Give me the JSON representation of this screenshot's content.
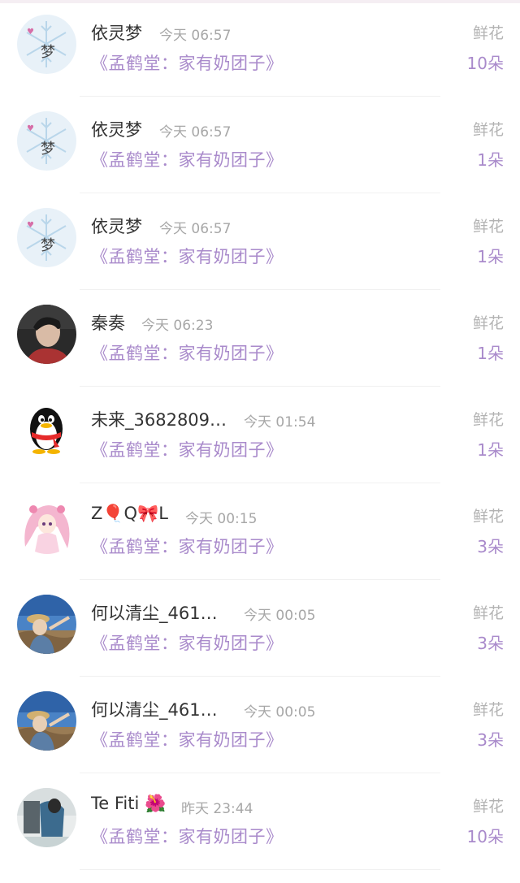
{
  "rows": [
    {
      "name": "依灵梦",
      "time": "今天 06:57",
      "book": "《孟鹤堂：家有奶团子》",
      "gift": "鲜花",
      "count": "10朵",
      "avatar": "avatar-snowflake"
    },
    {
      "name": "依灵梦",
      "time": "今天 06:57",
      "book": "《孟鹤堂：家有奶团子》",
      "gift": "鲜花",
      "count": "1朵",
      "avatar": "avatar-snowflake"
    },
    {
      "name": "依灵梦",
      "time": "今天 06:57",
      "book": "《孟鹤堂：家有奶团子》",
      "gift": "鲜花",
      "count": "1朵",
      "avatar": "avatar-snowflake"
    },
    {
      "name": "秦奏",
      "time": "今天 06:23",
      "book": "《孟鹤堂：家有奶团子》",
      "gift": "鲜花",
      "count": "1朵",
      "avatar": "avatar-photo-person"
    },
    {
      "name": "未来_3682809…",
      "time": "今天 01:54",
      "book": "《孟鹤堂：家有奶团子》",
      "gift": "鲜花",
      "count": "1朵",
      "avatar": "avatar-qq-penguin"
    },
    {
      "name": "Z🎈Q🎀L",
      "time": "今天 00:15",
      "book": "《孟鹤堂：家有奶团子》",
      "gift": "鲜花",
      "count": "3朵",
      "avatar": "avatar-anime-girl"
    },
    {
      "name": "何以清尘_461…",
      "time": "今天 00:05",
      "book": "《孟鹤堂：家有奶团子》",
      "gift": "鲜花",
      "count": "3朵",
      "avatar": "avatar-beach"
    },
    {
      "name": "何以清尘_461…",
      "time": "今天 00:05",
      "book": "《孟鹤堂：家有奶团子》",
      "gift": "鲜花",
      "count": "3朵",
      "avatar": "avatar-beach"
    },
    {
      "name": "Te Fiti 🌺",
      "time": "昨天 23:44",
      "book": "《孟鹤堂：家有奶团子》",
      "gift": "鲜花",
      "count": "10朵",
      "avatar": "avatar-girl-outdoor"
    }
  ],
  "avatar_text": {
    "snowflake": "梦"
  },
  "colors": {
    "accent": "#a98acb",
    "name": "#333333",
    "muted": "#a7a7a7"
  }
}
